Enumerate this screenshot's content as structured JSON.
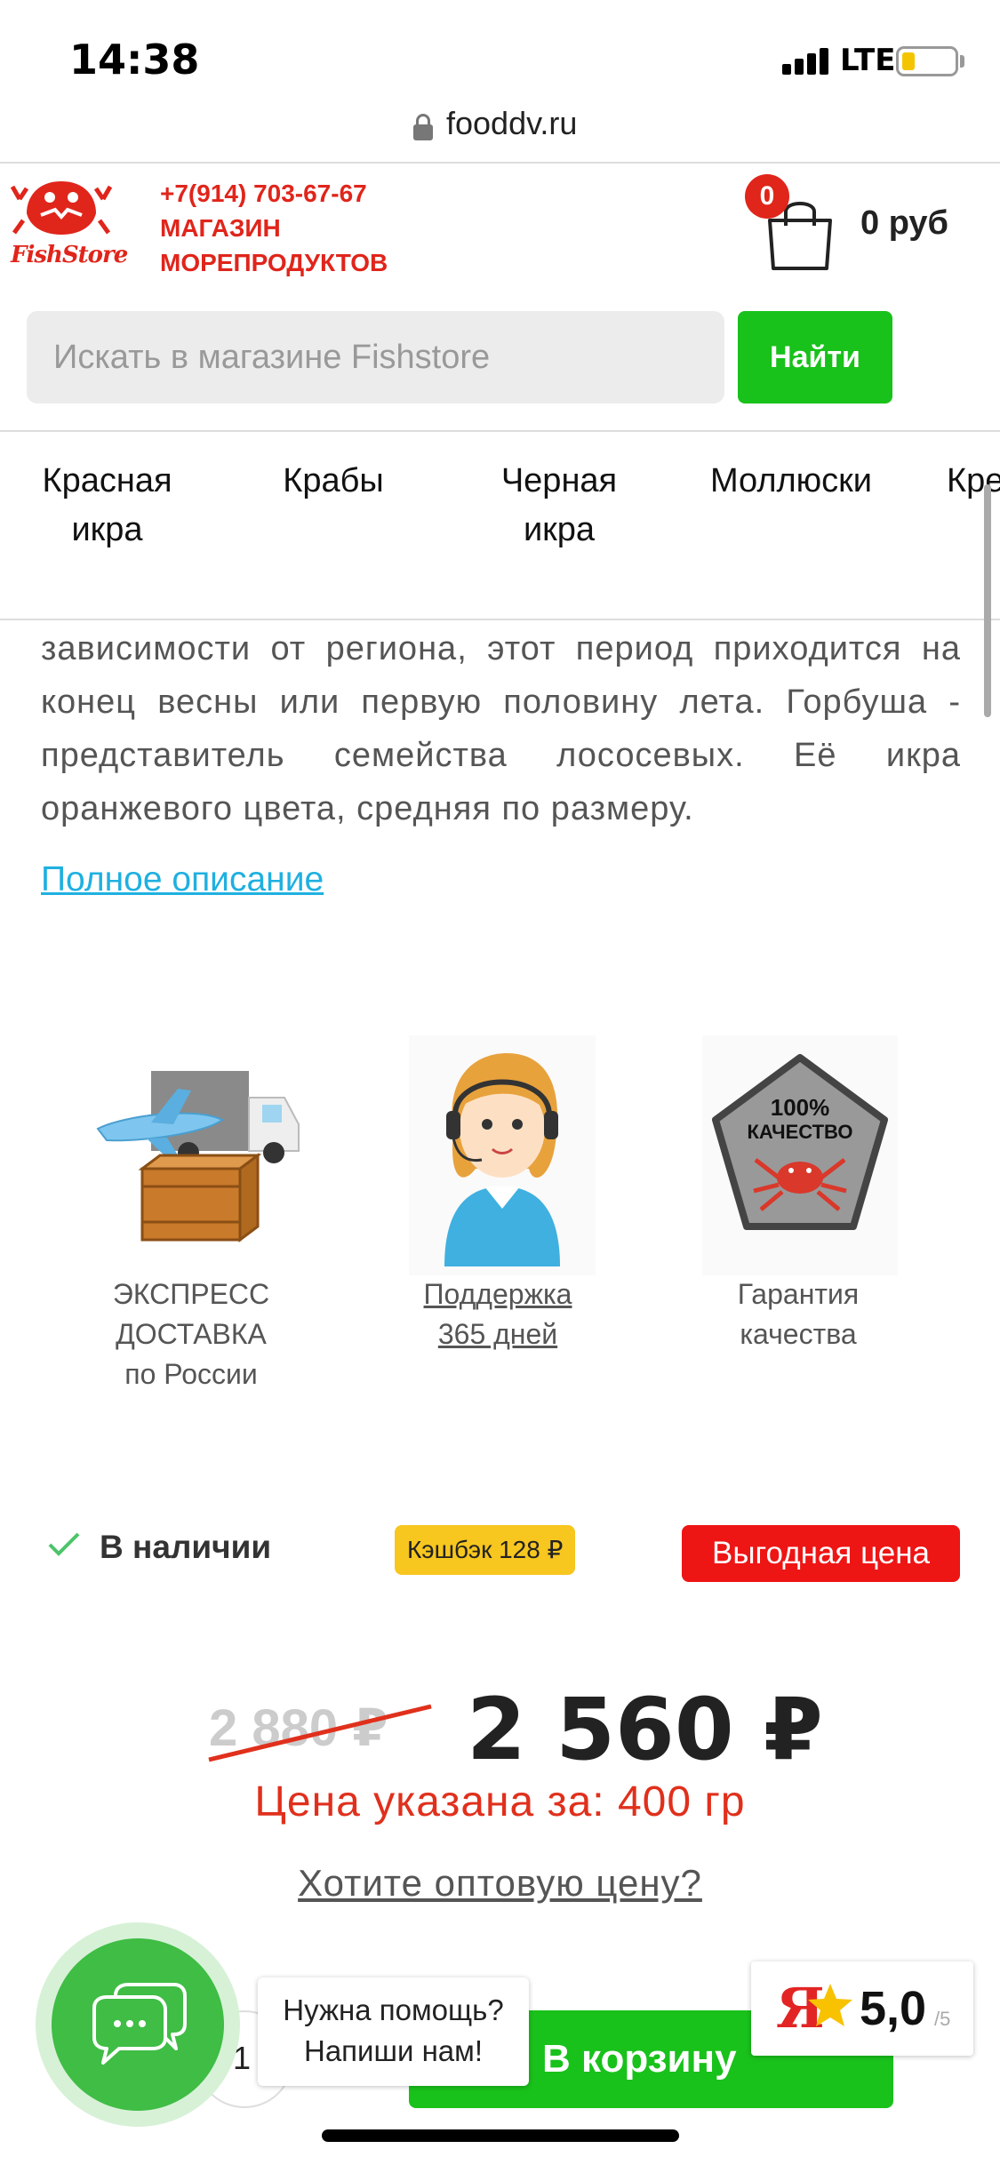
{
  "status_bar": {
    "time": "14:38",
    "network": "LTE"
  },
  "browser": {
    "url": "fooddv.ru"
  },
  "header": {
    "logo_text": "FishStore",
    "phone": "+7(914) 703-67-67",
    "tagline_line1": "МАГАЗИН",
    "tagline_line2": "МОРЕПРОДУКТОВ",
    "cart_count": "0",
    "cart_total": "0 руб"
  },
  "search": {
    "placeholder": "Искать в магазине Fishstore",
    "button_label": "Найти"
  },
  "categories": [
    {
      "line1": "Красная",
      "line2": "икра"
    },
    {
      "line1": "Крабы",
      "line2": ""
    },
    {
      "line1": "Черная",
      "line2": "икра"
    },
    {
      "line1": "Моллюски",
      "line2": ""
    },
    {
      "line1": "Кре",
      "line2": ""
    }
  ],
  "description": {
    "text": "зависимости от региона, этот период приходится на конец весны или первую половину лета. Горбуша - представитель семейства лососевых. Её икра оранжевого цвета, средняя по размеру.",
    "full_link": "Полное описание"
  },
  "features": [
    {
      "icon": "delivery-icon",
      "line1": "ЭКСПРЕСС",
      "line2": "ДОСТАВКА",
      "line3": "по России"
    },
    {
      "icon": "support-operator-icon",
      "line1": "Поддержка",
      "line2": "365 дней"
    },
    {
      "icon": "quality-badge-icon",
      "line1": "Гарантия",
      "line2": "качества",
      "badge_line1": "100%",
      "badge_line2": "КАЧЕСТВО"
    }
  ],
  "product": {
    "availability": "В наличии",
    "cashback": "Кэшбэк 128 ₽",
    "best_price_label": "Выгодная цена",
    "old_price": "2 880 ₽",
    "price": "2 560 ₽",
    "price_note": "Цена указана за: 400 гр",
    "wholesale_link": "Хотите оптовую цену?",
    "quantity": "1",
    "add_to_cart": "В корзину"
  },
  "chat": {
    "line1": "Нужна помощь?",
    "line2": "Напиши нам!"
  },
  "rating": {
    "brand": "Я",
    "value": "5,0",
    "max": "/5"
  },
  "colors": {
    "brand_red": "#e0251b",
    "accent_green": "#19c11b",
    "link_blue": "#1fb0e0",
    "cashback_yellow": "#f7c61f",
    "best_price_red": "#ee1515"
  }
}
